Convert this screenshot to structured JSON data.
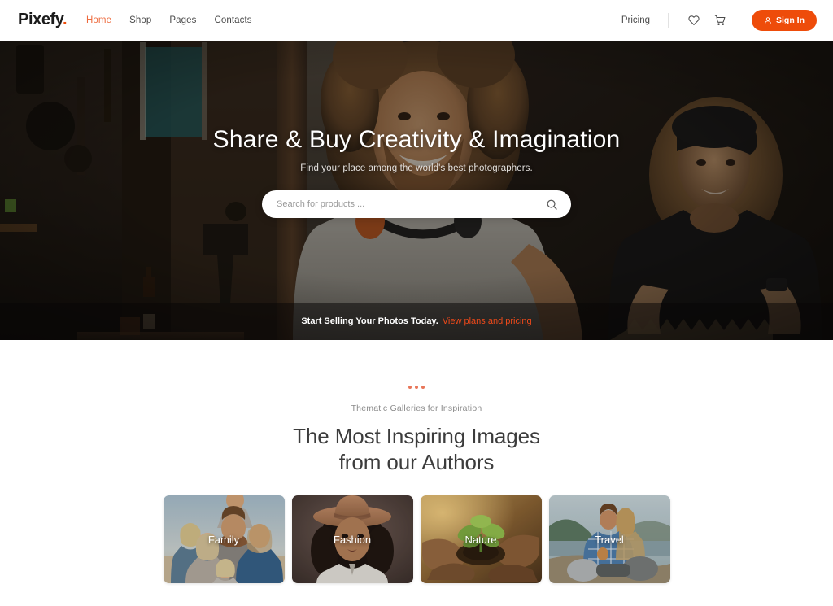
{
  "header": {
    "logo_text": "Pixefy",
    "logo_dot": ".",
    "nav": [
      {
        "label": "Home",
        "active": true
      },
      {
        "label": "Shop",
        "active": false
      },
      {
        "label": "Pages",
        "active": false
      },
      {
        "label": "Contacts",
        "active": false
      }
    ],
    "pricing_label": "Pricing",
    "wishlist_icon": "heart-icon",
    "cart_icon": "cart-icon",
    "signin_label": "Sign In",
    "signin_icon": "user-icon",
    "accent_color": "#ee4c0a"
  },
  "hero": {
    "title": "Share & Buy Creativity & Imagination",
    "subtitle": "Find your place among the world's best photographers.",
    "search_placeholder": "Search for products ...",
    "search_value": "",
    "search_icon": "search-icon",
    "banner_text": "Start Selling Your Photos Today.",
    "banner_link": "View plans and pricing",
    "banner_link_color": "#ef4a1a"
  },
  "galleries": {
    "eyebrow": "Thematic Galleries for Inspiration",
    "title_line1": "The Most Inspiring Images",
    "title_line2": "from our Authors",
    "dot_color": "#e8765a",
    "cards": [
      {
        "label": "Family"
      },
      {
        "label": "Fashion"
      },
      {
        "label": "Nature"
      },
      {
        "label": "Travel"
      }
    ]
  }
}
